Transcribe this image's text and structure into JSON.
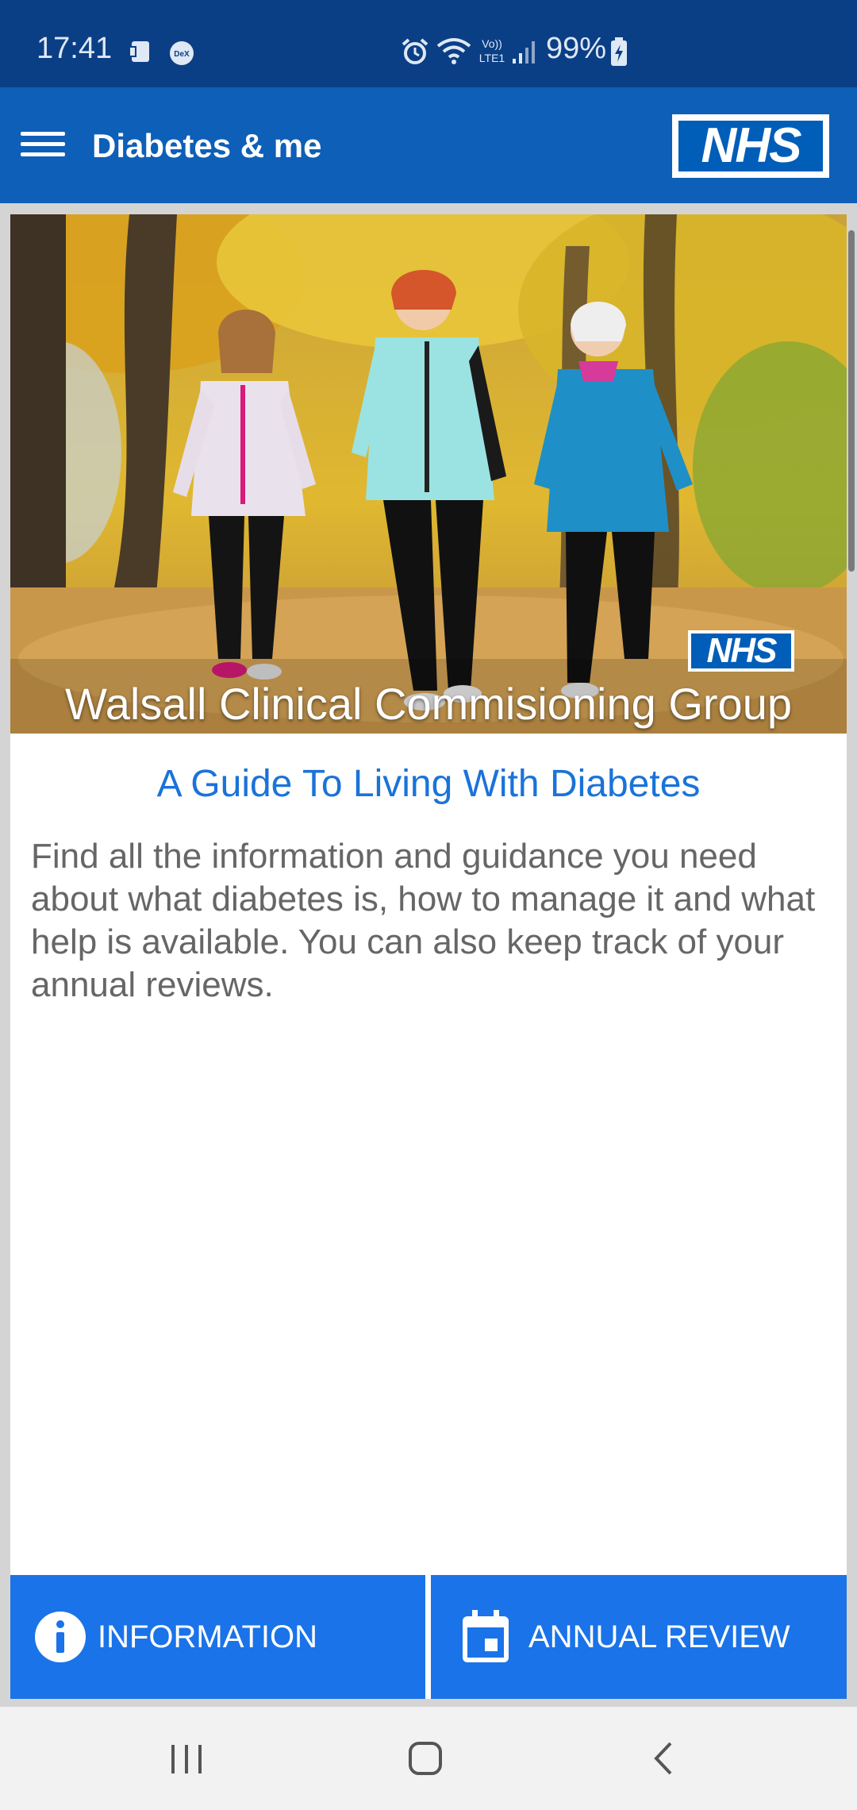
{
  "status_bar": {
    "time": "17:41",
    "battery": "99%",
    "network": "LTE1",
    "icons": [
      "screenshot-icon",
      "dex-icon",
      "alarm-icon",
      "wifi-icon",
      "volte-icon",
      "signal-icon",
      "battery-charging-icon"
    ]
  },
  "app_bar": {
    "title": "Diabetes & me",
    "logo": "NHS"
  },
  "hero": {
    "logo": "NHS",
    "caption": "Walsall Clinical Commisioning Group"
  },
  "content": {
    "title": "A Guide To Living With Diabetes",
    "description": "Find all the information and guidance you need about what diabetes is, how to manage it and what help is available. You can also keep track of your annual reviews."
  },
  "buttons": {
    "information": "INFORMATION",
    "annual_review": "ANNUAL REVIEW"
  },
  "colors": {
    "status_bar": "#0b3f85",
    "app_bar": "#0d5fb8",
    "nhs_blue": "#005eb8",
    "accent": "#1a73e8",
    "title_text": "#1a73d9"
  }
}
